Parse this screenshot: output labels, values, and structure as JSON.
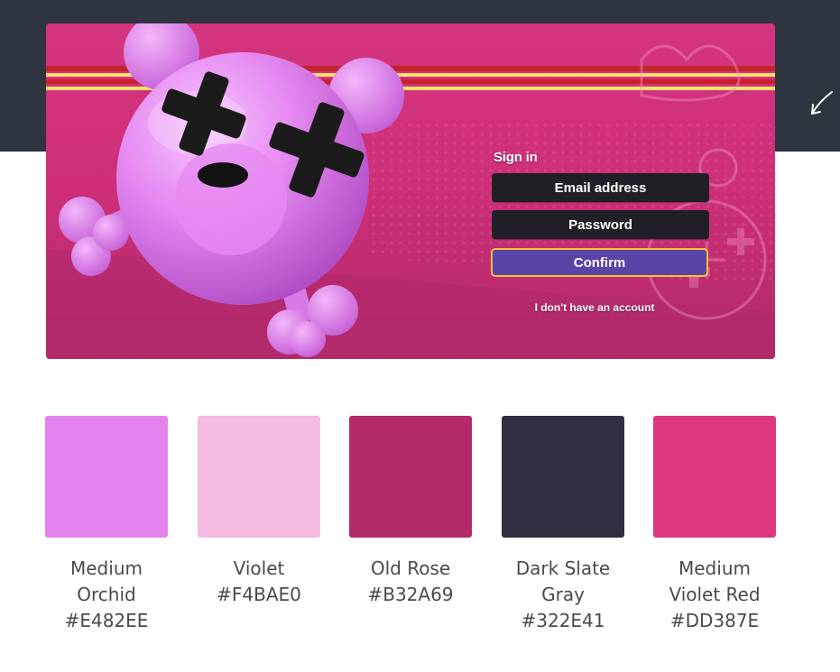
{
  "login": {
    "signin_label": "Sign in",
    "email_placeholder": "Email address",
    "password_placeholder": "Password",
    "confirm_label": "Confirm",
    "no_account_link": "I don't have an account"
  },
  "palette": [
    {
      "name": "Medium Orchid",
      "hex": "#E482EE",
      "color": "#e482ee"
    },
    {
      "name": "Violet",
      "hex": "#F4BAE0",
      "color": "#f4bae0"
    },
    {
      "name": "Old Rose",
      "hex": "#B32A69",
      "color": "#b32a69"
    },
    {
      "name": "Dark Slate Gray",
      "hex": "#322E41",
      "color": "#322e41"
    },
    {
      "name": "Medium Violet Red",
      "hex": "#DD387E",
      "color": "#dd387e"
    }
  ],
  "colors": {
    "header_band": "#2e3440",
    "hero_pink": "#d4347e",
    "field_dark": "#1f1f25",
    "confirm_purple": "#5a44a6",
    "confirm_border": "#f5c03a"
  },
  "icons": [
    "arrow-icon",
    "mascot-illustration",
    "plus-icon"
  ]
}
